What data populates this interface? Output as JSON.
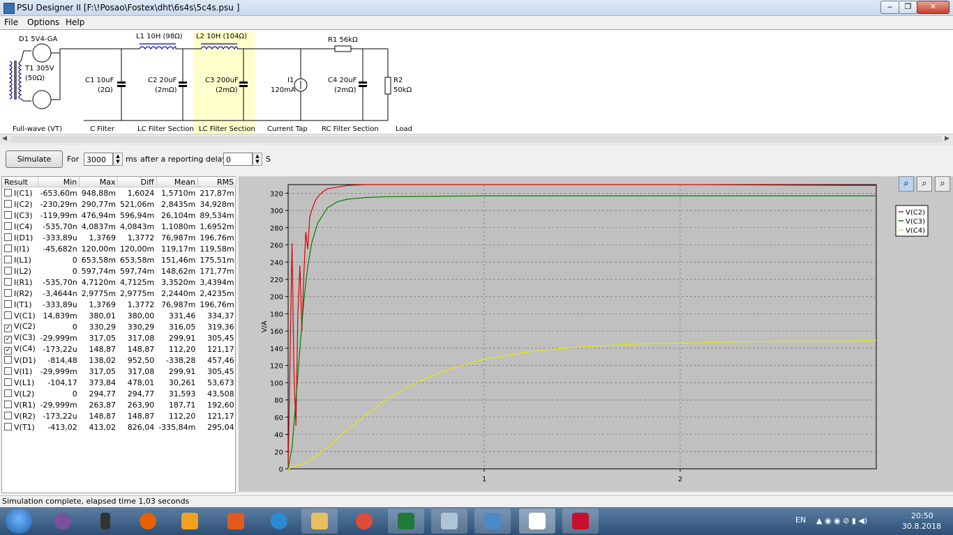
{
  "window": {
    "title": "PSU Designer II  [F:\\!Posao\\Fostex\\dht\\6s4s\\5c4s.psu ]"
  },
  "menu": {
    "items": [
      "File",
      "Options",
      "Help"
    ]
  },
  "schematic": {
    "rectifier": {
      "name": "D1 5V4-GA",
      "transformer": "T1 305V",
      "transformer_r": "(50Ω)",
      "section": "Full-wave (VT)"
    },
    "c1": {
      "name": "C1 10uF",
      "esr": "(2Ω)",
      "section": "C Filter"
    },
    "l1": {
      "name": "L1 10H (98Ω)"
    },
    "c2": {
      "name": "C2 20uF",
      "esr": "(2mΩ)",
      "section": "LC Filter Section"
    },
    "l2": {
      "name": "L2 10H (104Ω)"
    },
    "c3": {
      "name": "C3 200uF",
      "esr": "(2mΩ)",
      "section": "LC Filter Section"
    },
    "i1": {
      "name": "I1",
      "value": "120mA",
      "section": "Current Tap"
    },
    "r1": {
      "name": "R1 56kΩ"
    },
    "c4": {
      "name": "C4 20uF",
      "esr": "(2mΩ)",
      "section": "RC Filter Section"
    },
    "r2": {
      "name": "R2",
      "value": "50kΩ",
      "section": "Load"
    }
  },
  "simulate": {
    "button": "Simulate",
    "for_label": "For",
    "duration": "3000",
    "ms_label": "ms",
    "delay_label": "after a reporting delay of",
    "delay": "0",
    "s_label": "S"
  },
  "results": {
    "columns": [
      "Result",
      "Min",
      "Max",
      "Diff",
      "Mean",
      "RMS"
    ],
    "rows": [
      {
        "name": "I(C1)",
        "checked": false,
        "min": "-653,60m",
        "max": "948,88m",
        "diff": "1,6024",
        "mean": "1,5710m",
        "rms": "217,87m"
      },
      {
        "name": "I(C2)",
        "checked": false,
        "min": "-230,29m",
        "max": "290,77m",
        "diff": "521,06m",
        "mean": "2,8435m",
        "rms": "34,928m"
      },
      {
        "name": "I(C3)",
        "checked": false,
        "min": "-119,99m",
        "max": "476,94m",
        "diff": "596,94m",
        "mean": "26,104m",
        "rms": "89,534m"
      },
      {
        "name": "I(C4)",
        "checked": false,
        "min": "-535,70n",
        "max": "4,0837m",
        "diff": "4,0843m",
        "mean": "1,1080m",
        "rms": "1,6952m"
      },
      {
        "name": "I(D1)",
        "checked": false,
        "min": "-333,89u",
        "max": "1,3769",
        "diff": "1,3772",
        "mean": "76,987m",
        "rms": "196,76m"
      },
      {
        "name": "I(I1)",
        "checked": false,
        "min": "-45,682n",
        "max": "120,00m",
        "diff": "120,00m",
        "mean": "119,17m",
        "rms": "119,58m"
      },
      {
        "name": "I(L1)",
        "checked": false,
        "min": "0",
        "max": "653,58m",
        "diff": "653,58m",
        "mean": "151,46m",
        "rms": "175,51m"
      },
      {
        "name": "I(L2)",
        "checked": false,
        "min": "0",
        "max": "597,74m",
        "diff": "597,74m",
        "mean": "148,62m",
        "rms": "171,77m"
      },
      {
        "name": "I(R1)",
        "checked": false,
        "min": "-535,70n",
        "max": "4,7120m",
        "diff": "4,7125m",
        "mean": "3,3520m",
        "rms": "3,4394m"
      },
      {
        "name": "I(R2)",
        "checked": false,
        "min": "-3,4644n",
        "max": "2,9775m",
        "diff": "2,9775m",
        "mean": "2,2440m",
        "rms": "2,4235m"
      },
      {
        "name": "I(T1)",
        "checked": false,
        "min": "-333,89u",
        "max": "1,3769",
        "diff": "1,3772",
        "mean": "76,987m",
        "rms": "196,76m"
      },
      {
        "name": "V(C1)",
        "checked": false,
        "min": "14,839m",
        "max": "380,01",
        "diff": "380,00",
        "mean": "331,46",
        "rms": "334,37"
      },
      {
        "name": "V(C2)",
        "checked": true,
        "min": "0",
        "max": "330,29",
        "diff": "330,29",
        "mean": "316,05",
        "rms": "319,36"
      },
      {
        "name": "V(C3)",
        "checked": true,
        "min": "-29,999m",
        "max": "317,05",
        "diff": "317,08",
        "mean": "299,91",
        "rms": "305,45"
      },
      {
        "name": "V(C4)",
        "checked": true,
        "min": "-173,22u",
        "max": "148,87",
        "diff": "148,87",
        "mean": "112,20",
        "rms": "121,17"
      },
      {
        "name": "V(D1)",
        "checked": false,
        "min": "-814,48",
        "max": "138,02",
        "diff": "952,50",
        "mean": "-338,28",
        "rms": "457,46"
      },
      {
        "name": "V(I1)",
        "checked": false,
        "min": "-29,999m",
        "max": "317,05",
        "diff": "317,08",
        "mean": "299,91",
        "rms": "305,45"
      },
      {
        "name": "V(L1)",
        "checked": false,
        "min": "-104,17",
        "max": "373,84",
        "diff": "478,01",
        "mean": "30,261",
        "rms": "53,673"
      },
      {
        "name": "V(L2)",
        "checked": false,
        "min": "0",
        "max": "294,77",
        "diff": "294,77",
        "mean": "31,593",
        "rms": "43,508"
      },
      {
        "name": "V(R1)",
        "checked": false,
        "min": "-29,999m",
        "max": "263,87",
        "diff": "263,90",
        "mean": "187,71",
        "rms": "192,60"
      },
      {
        "name": "V(R2)",
        "checked": false,
        "min": "-173,22u",
        "max": "148,87",
        "diff": "148,87",
        "mean": "112,20",
        "rms": "121,17"
      },
      {
        "name": "V(T1)",
        "checked": false,
        "min": "-413,02",
        "max": "413,02",
        "diff": "826,04",
        "mean": "-335,84m",
        "rms": "295,04"
      }
    ]
  },
  "chart_data": {
    "type": "line",
    "ylabel": "V/A",
    "xlim": [
      0,
      3
    ],
    "ylim": [
      0,
      330
    ],
    "yticks": [
      0,
      20,
      40,
      60,
      80,
      100,
      120,
      140,
      160,
      180,
      200,
      220,
      240,
      260,
      280,
      300,
      320
    ],
    "xticks": [
      1,
      2
    ],
    "grid": true,
    "legend_position": "top-right",
    "series": [
      {
        "name": "V(C2)",
        "color": "#e00000",
        "x": [
          0,
          0.01,
          0.02,
          0.03,
          0.04,
          0.05,
          0.06,
          0.07,
          0.08,
          0.09,
          0.1,
          0.11,
          0.12,
          0.14,
          0.16,
          0.18,
          0.2,
          0.25,
          0.3,
          0.4,
          0.5,
          1,
          2,
          3
        ],
        "y": [
          0,
          130,
          262,
          110,
          50,
          180,
          236,
          160,
          225,
          275,
          255,
          292,
          300,
          312,
          318,
          322,
          325,
          327,
          329,
          330,
          330,
          330,
          330,
          329
        ]
      },
      {
        "name": "V(C3)",
        "color": "#008000",
        "x": [
          0,
          0.02,
          0.04,
          0.06,
          0.08,
          0.1,
          0.12,
          0.15,
          0.2,
          0.25,
          0.3,
          0.4,
          0.5,
          1,
          2,
          3
        ],
        "y": [
          0,
          25,
          80,
          140,
          195,
          235,
          262,
          285,
          303,
          310,
          313,
          315,
          316,
          317,
          317,
          317
        ],
        "y_gap_note": ""
      },
      {
        "name": "V(C4)",
        "color": "#e8e800",
        "x": [
          0,
          0.1,
          0.2,
          0.3,
          0.4,
          0.5,
          0.6,
          0.7,
          0.8,
          0.9,
          1.0,
          1.2,
          1.4,
          1.6,
          1.8,
          2.0,
          2.2,
          2.5,
          2.8,
          3.0
        ],
        "y": [
          0,
          8,
          25,
          45,
          63,
          80,
          94,
          105,
          114,
          121,
          127,
          135,
          140,
          143,
          145,
          146,
          147,
          148,
          148,
          149
        ]
      }
    ]
  },
  "status": {
    "text": "Simulation complete, elapsed time 1,03 seconds"
  },
  "taskbar": {
    "lang": "EN",
    "time": "20:50",
    "date": "30.8.2018"
  }
}
